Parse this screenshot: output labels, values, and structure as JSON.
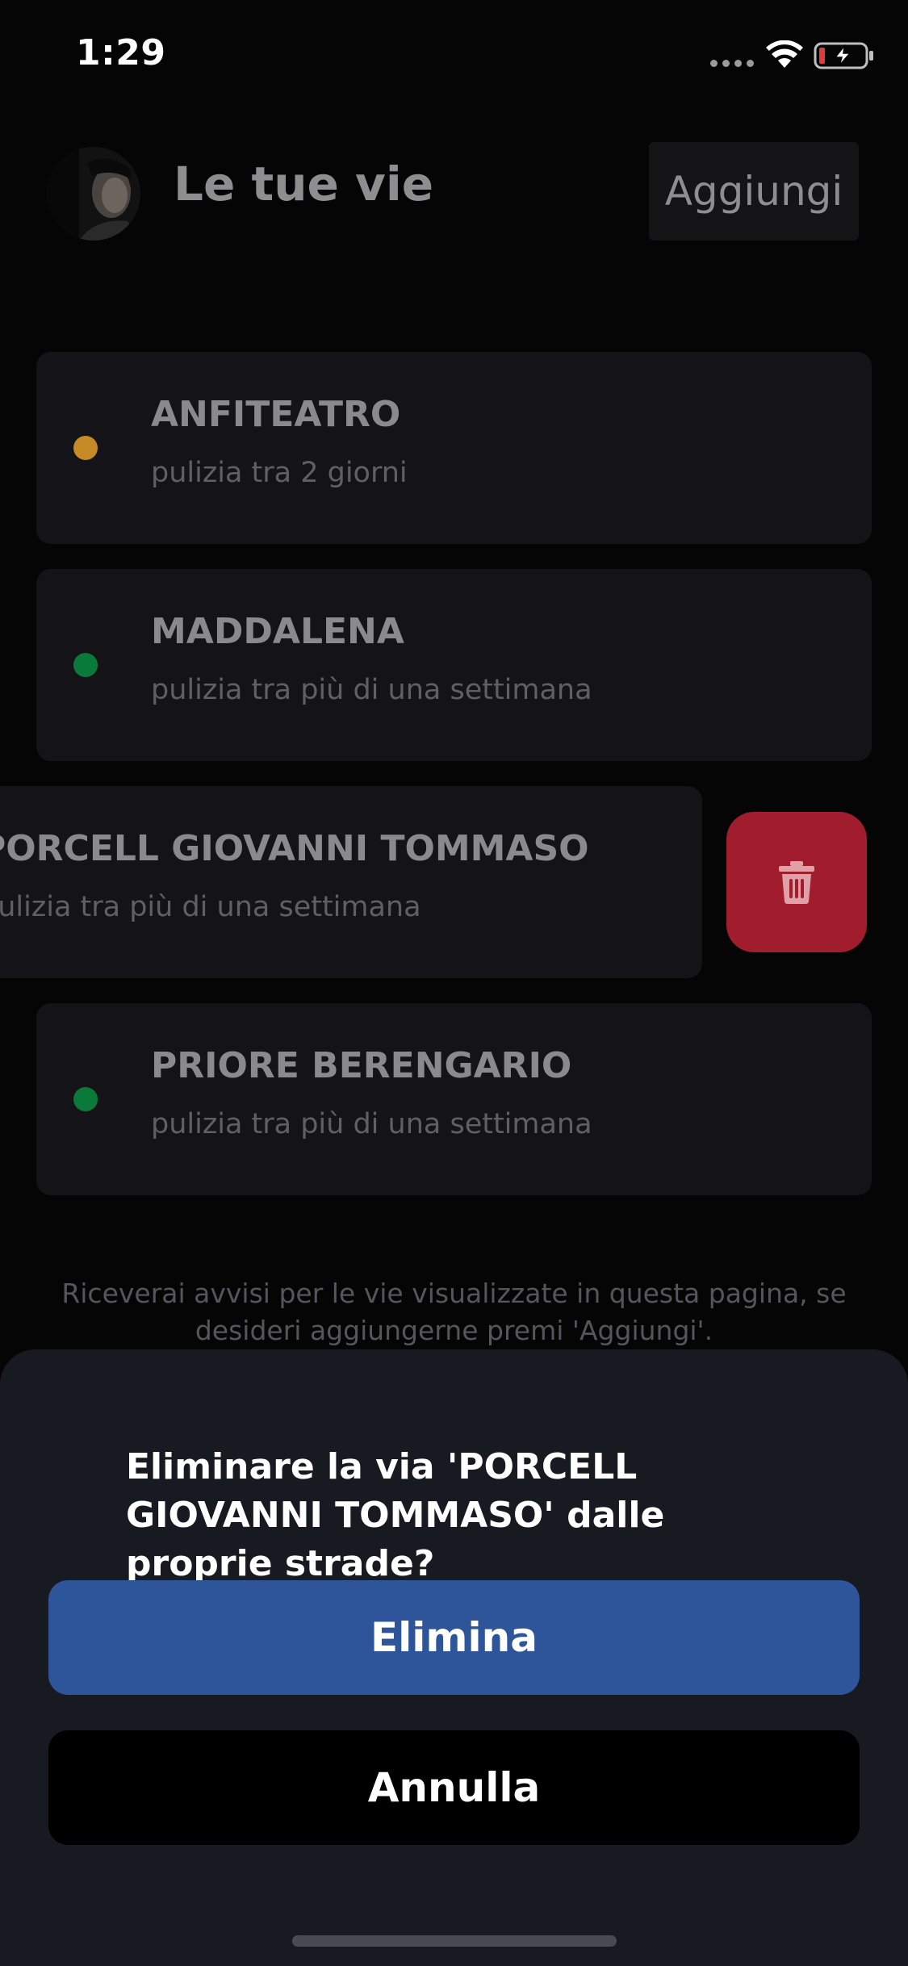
{
  "status_bar": {
    "time": "1:29"
  },
  "header": {
    "title": "Le tue vie",
    "add_label": "Aggiungi"
  },
  "streets": [
    {
      "name": "ANFITEATRO",
      "status": "pulizia tra 2 giorni",
      "dot_color": "#c58a25"
    },
    {
      "name": "MADDALENA",
      "status": "pulizia tra più di una settimana",
      "dot_color": "#0a7a3a"
    },
    {
      "name": "PORCELL GIOVANNI TOMMASO",
      "status": "pulizia tra più di una settimana",
      "dot_color": "#0a7a3a"
    },
    {
      "name": "PRIORE BERENGARIO",
      "status": "pulizia tra più di una settimana",
      "dot_color": "#0a7a3a"
    }
  ],
  "info_note": "Riceverai avvisi per le vie visualizzate in questa pagina, se desideri aggiungerne premi 'Aggiungi'.",
  "delete_sheet": {
    "question": "Eliminare la via 'PORCELL GIOVANNI TOMMASO' dalle proprie strade?",
    "confirm_label": "Elimina",
    "cancel_label": "Annulla"
  },
  "colors": {
    "delete_action": "#a11d2e",
    "confirm_button": "#2e559a",
    "sheet_background": "#181a22"
  },
  "icons": {
    "delete_action": "trash-icon",
    "wifi": "wifi-icon",
    "battery": "battery-charging-icon"
  }
}
